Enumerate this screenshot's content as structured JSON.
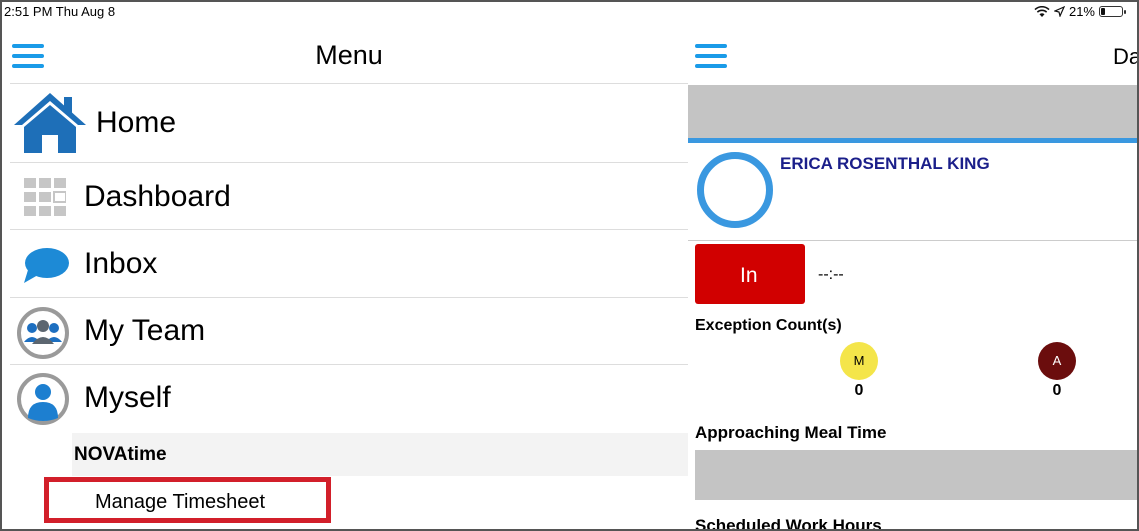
{
  "status_bar": {
    "time_date": "2:51 PM  Thu Aug 8",
    "battery": "21%",
    "battery_level": 0.21
  },
  "menu": {
    "title": "Menu",
    "items": [
      {
        "label": "Home",
        "icon": "home-icon"
      },
      {
        "label": "Dashboard",
        "icon": "dashboard-grid-icon"
      },
      {
        "label": "Inbox",
        "icon": "chat-bubble-icon"
      },
      {
        "label": "My Team",
        "icon": "team-icon"
      },
      {
        "label": "Myself",
        "icon": "user-icon"
      }
    ],
    "section_header": "NOVAtime",
    "sub_item": "Manage Timesheet"
  },
  "dashboard": {
    "title": "Da",
    "employee_name": "ERICA  ROSENTHAL KING",
    "punch_button": "In",
    "last_punch": "--:--",
    "exception_label": "Exception Count(s)",
    "exceptions": [
      {
        "letter": "M",
        "count": "0",
        "color": "#f4e54a"
      },
      {
        "letter": "A",
        "count": "0",
        "color": "#6b0d0d"
      }
    ],
    "meal_label": "Approaching Meal Time",
    "scheduled_label": "Scheduled Work Hours"
  },
  "colors": {
    "accent": "#1a9be8",
    "highlight_border": "#d21f2a",
    "punch_red": "#d10000",
    "name_blue": "#1b1f8a"
  }
}
